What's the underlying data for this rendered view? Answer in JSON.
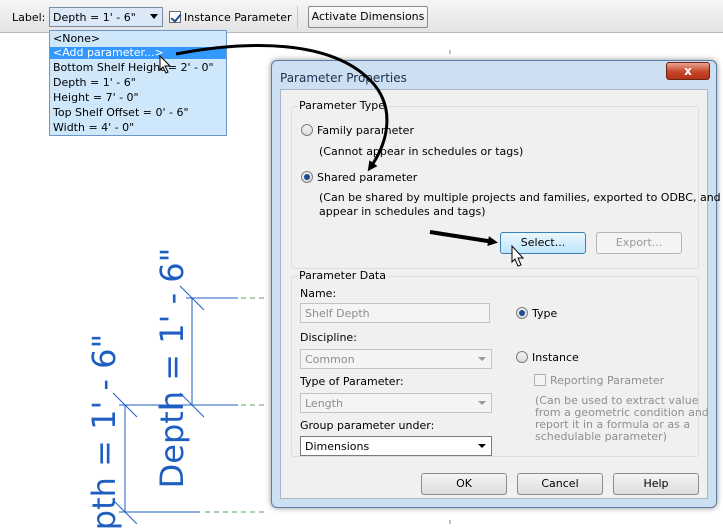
{
  "options_bar": {
    "label": "Label:",
    "label_value": "Depth = 1' - 6\"",
    "instance_parameter": "Instance Parameter",
    "instance_checked": true,
    "activate_dimensions": "Activate Dimensions"
  },
  "label_dropdown": {
    "items": [
      "<None>",
      "<Add parameter...>",
      "Bottom Shelf Height = 2' - 0\"",
      "Depth = 1' - 6\"",
      "Height = 7' - 0\"",
      "Top Shelf Offset = 0' - 6\"",
      "Width = 4' - 0\""
    ],
    "selected_index": 1
  },
  "drawing": {
    "dimension_label": "Depth = 1' - 6\"",
    "dimension_label_partial": "pth = 1' - 6\"",
    "line_color": "#1f5fc2"
  },
  "dialog": {
    "title": "Parameter Properties",
    "close_label": "x",
    "parameter_type": {
      "group_title": "Parameter Type",
      "family_option": "Family parameter",
      "family_note": "(Cannot appear in schedules or tags)",
      "shared_option": "Shared parameter",
      "shared_note_1": "(Can be shared by multiple projects and families, exported to ODBC, and",
      "shared_note_2": "appear in schedules and tags)",
      "selected": "shared",
      "select_button": "Select...",
      "export_button": "Export..."
    },
    "parameter_data": {
      "group_title": "Parameter Data",
      "name_label": "Name:",
      "name_value": "Shelf Depth",
      "discipline_label": "Discipline:",
      "discipline_value": "Common",
      "type_label": "Type of Parameter:",
      "type_value": "Length",
      "group_label": "Group parameter under:",
      "group_value": "Dimensions",
      "type_option": "Type",
      "instance_option": "Instance",
      "selected": "type",
      "reporting_label": "Reporting Parameter",
      "reporting_note": [
        "(Can be used to extract value",
        "from a geometric condition and",
        "report it in a formula or as a",
        "schedulable parameter)"
      ]
    },
    "buttons": {
      "ok": "OK",
      "cancel": "Cancel",
      "help": "Help"
    }
  }
}
